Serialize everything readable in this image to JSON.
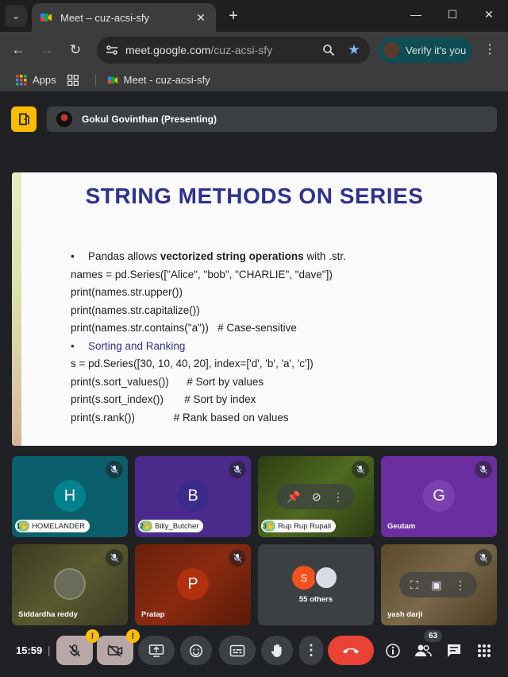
{
  "browser": {
    "tab_title": "Meet – cuz-acsi-sfy",
    "url_host": "meet.google.com",
    "url_path": "/cuz-acsi-sfy",
    "verify_label": "Verify it's you",
    "bookmarks": [
      {
        "label": "Apps"
      },
      {
        "label": "Meet - cuz-acsi-sfy"
      }
    ]
  },
  "meet": {
    "presenter_label": "Gokul Govinthan (Presenting)",
    "slide": {
      "title": "STRING METHODS ON SERIES",
      "lines": [
        {
          "bullet": "•",
          "pre": "Pandas allows ",
          "bold": "vectorized string operations",
          "post": " with .str."
        },
        {
          "text": "names = pd.Series([\"Alice\", \"bob\", \"CHARLIE\", \"dave\"])"
        },
        {
          "text": "print(names.str.upper())"
        },
        {
          "text": "print(names.str.capitalize())"
        },
        {
          "text": "print(names.str.contains(\"a\"))   # Case-sensitive"
        },
        {
          "bullet": "•",
          "text": "Sorting and Ranking"
        },
        {
          "text": "s = pd.Series([30, 10, 40, 20], index=['d', 'b', 'a', 'c'])"
        },
        {
          "text": "print(s.sort_values())      # Sort by values"
        },
        {
          "text": "print(s.sort_index())       # Sort by index"
        },
        {
          "text": "print(s.rank())             # Rank based on values"
        }
      ]
    },
    "participants": [
      {
        "initial": "H",
        "name": "HOMELANDER",
        "hand": "1",
        "bg": "#0b5e6b",
        "avatar_bg": "#00838f"
      },
      {
        "initial": "B",
        "name": "Billy_Butcher",
        "hand": "2",
        "bg": "#4a2a8a",
        "avatar_bg": "#3c2a8c"
      },
      {
        "initial": "",
        "name": "Rup Rup Rupali",
        "hand": "3",
        "bg": "#3a4a1a",
        "avatar_bg": "#2f4f1f"
      },
      {
        "initial": "G",
        "name": "Geutam",
        "hand": "",
        "bg": "#6a2ea0",
        "avatar_bg": "#7b3fb0"
      },
      {
        "initial": "",
        "name": "Siddardha reddy",
        "hand": "",
        "bg": "#4a4a2a",
        "avatar_bg": "#6b6b5a"
      },
      {
        "initial": "P",
        "name": "Pratap",
        "hand": "",
        "bg": "#8a2a10",
        "avatar_bg": "#b3300f"
      },
      {
        "initial": "S",
        "name": "55 others",
        "hand": "",
        "bg": "#3c4043",
        "avatar_bg": "#f4511e"
      },
      {
        "initial": "",
        "name": "yash darji",
        "hand": "",
        "bg": "#6b5a3a",
        "avatar_bg": "#7a6a4a"
      }
    ],
    "clock": "15:59",
    "clock_sep": "|",
    "people_count": "63"
  }
}
